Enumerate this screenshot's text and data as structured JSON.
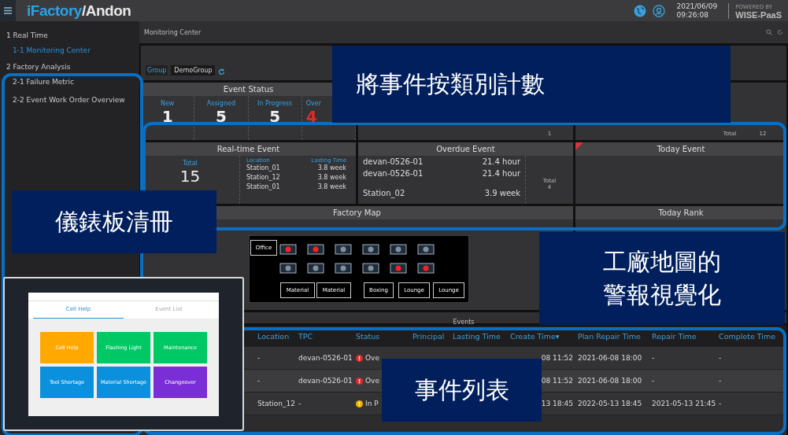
{
  "header": {
    "brand": "iFactory",
    "product": "/Andon",
    "date": "2021/06/09",
    "time": "09:26:08",
    "powered_by": "POWERED BY",
    "platform": "WISE-PaaS"
  },
  "sidebar": {
    "items": [
      {
        "label": "1 Real Time",
        "selected": false,
        "children": [
          {
            "label": "1-1 Monitoring Center",
            "selected": true
          }
        ]
      },
      {
        "label": "2 Factory Analysis",
        "selected": false,
        "children": [
          {
            "label": "2-1 Failure Metric",
            "selected": false
          },
          {
            "label": "2-2 Event Work Order Overview",
            "selected": false
          }
        ]
      }
    ]
  },
  "breadcrumb": "Monitoring Center",
  "filter": {
    "label": "Group",
    "value": "DemoGroup"
  },
  "event_status": {
    "title": "Event Status",
    "counts": [
      {
        "label": "New",
        "value": "1",
        "alert": false
      },
      {
        "label": "Assigned",
        "value": "5",
        "alert": false
      },
      {
        "label": "In Progress",
        "value": "5",
        "alert": false
      },
      {
        "label": "Over",
        "value": "4",
        "alert": true
      }
    ]
  },
  "status_panel_2": {
    "value": "1"
  },
  "status_panel_3": {
    "label": "Total",
    "value": "12"
  },
  "realtime_event": {
    "title": "Real-time Event",
    "total_label": "Total",
    "total": "15",
    "columns": [
      "Location",
      "Lasting Time"
    ],
    "rows": [
      [
        "Station_01",
        "3.8 week"
      ],
      [
        "Station_12",
        "3.8 week"
      ],
      [
        "Station_01",
        "3.8 week"
      ]
    ]
  },
  "overdue_event": {
    "title": "Overdue Event",
    "total_label": "Total",
    "total": "4",
    "rows": [
      [
        "devan-0526-01",
        "21.4 hour"
      ],
      [
        "devan-0526-01",
        "21.4 hour"
      ],
      [
        "Station_02",
        "3.9 week"
      ]
    ]
  },
  "today_event": {
    "title": "Today Event",
    "flagged": true
  },
  "factory_map": {
    "title": "Factory Map",
    "rooms": [
      "Office",
      "Material",
      "Material",
      "Boxing",
      "Lounge",
      "Lounge"
    ],
    "stations": [
      {
        "alert": true
      },
      {
        "alert": true
      },
      {
        "alert": false
      },
      {
        "alert": false
      },
      {
        "alert": false
      },
      {
        "alert": false
      },
      {
        "alert": false
      },
      {
        "alert": false
      },
      {
        "alert": false
      },
      {
        "alert": false
      },
      {
        "alert": true
      },
      {
        "alert": true
      }
    ]
  },
  "today_rank": {
    "title": "Today Rank"
  },
  "events": {
    "title": "Events",
    "sort_mark": "▾",
    "columns": [
      {
        "label": "Location",
        "sorted": false
      },
      {
        "label": "TPC",
        "sorted": false
      },
      {
        "label": "Status",
        "sorted": false
      },
      {
        "label": "Principal",
        "sorted": false
      },
      {
        "label": "Lasting Time",
        "sorted": false
      },
      {
        "label": "Create Time",
        "sorted": true
      },
      {
        "label": "Plan Repair Time",
        "sorted": false
      },
      {
        "label": "Repair Time",
        "sorted": false
      },
      {
        "label": "Complete Time",
        "sorted": false
      }
    ],
    "rows": [
      {
        "location": "-",
        "tpc": "devan-0526-01",
        "status": {
          "kind": "overdue",
          "text": "Ove"
        },
        "create": "08 11:52",
        "plan": "2021-06-08 18:00",
        "repair": "-",
        "complete": "-"
      },
      {
        "location": "-",
        "tpc": "devan-0526-01",
        "status": {
          "kind": "overdue",
          "text": "Ove"
        },
        "create": "08 11:52",
        "plan": "2021-06-08 18:00",
        "repair": "-",
        "complete": "-"
      },
      {
        "location": "Station_12",
        "tpc": "-",
        "status": {
          "kind": "progress",
          "text": "In P"
        },
        "create": "13 18:45",
        "plan": "2022-05-13 18:45",
        "repair": "2021-05-13 21:45",
        "complete": "-"
      }
    ]
  },
  "tablet": {
    "tabs": [
      {
        "label": "Cell Help",
        "selected": true
      },
      {
        "label": "Event List",
        "selected": false
      }
    ],
    "tiles": [
      {
        "label": "Cell Help",
        "color": "#ffa800"
      },
      {
        "label": "Flashing Light",
        "color": "#00c864"
      },
      {
        "label": "Maintenance",
        "color": "#00c864"
      },
      {
        "label": "Tool Shortage",
        "color": "#0a90dc"
      },
      {
        "label": "Material Shortage",
        "color": "#0a90dc"
      },
      {
        "label": "Changeover",
        "color": "#7a2ed6"
      }
    ]
  },
  "callouts": [
    {
      "kind": "counts",
      "lines": [
        "將事件按類別計數"
      ]
    },
    {
      "kind": "sidebar",
      "lines": [
        "儀錶板清冊"
      ]
    },
    {
      "kind": "map",
      "lines": [
        "工廠地圖的",
        "警報視覺化"
      ]
    },
    {
      "kind": "table",
      "lines": [
        "事件列表"
      ]
    }
  ]
}
